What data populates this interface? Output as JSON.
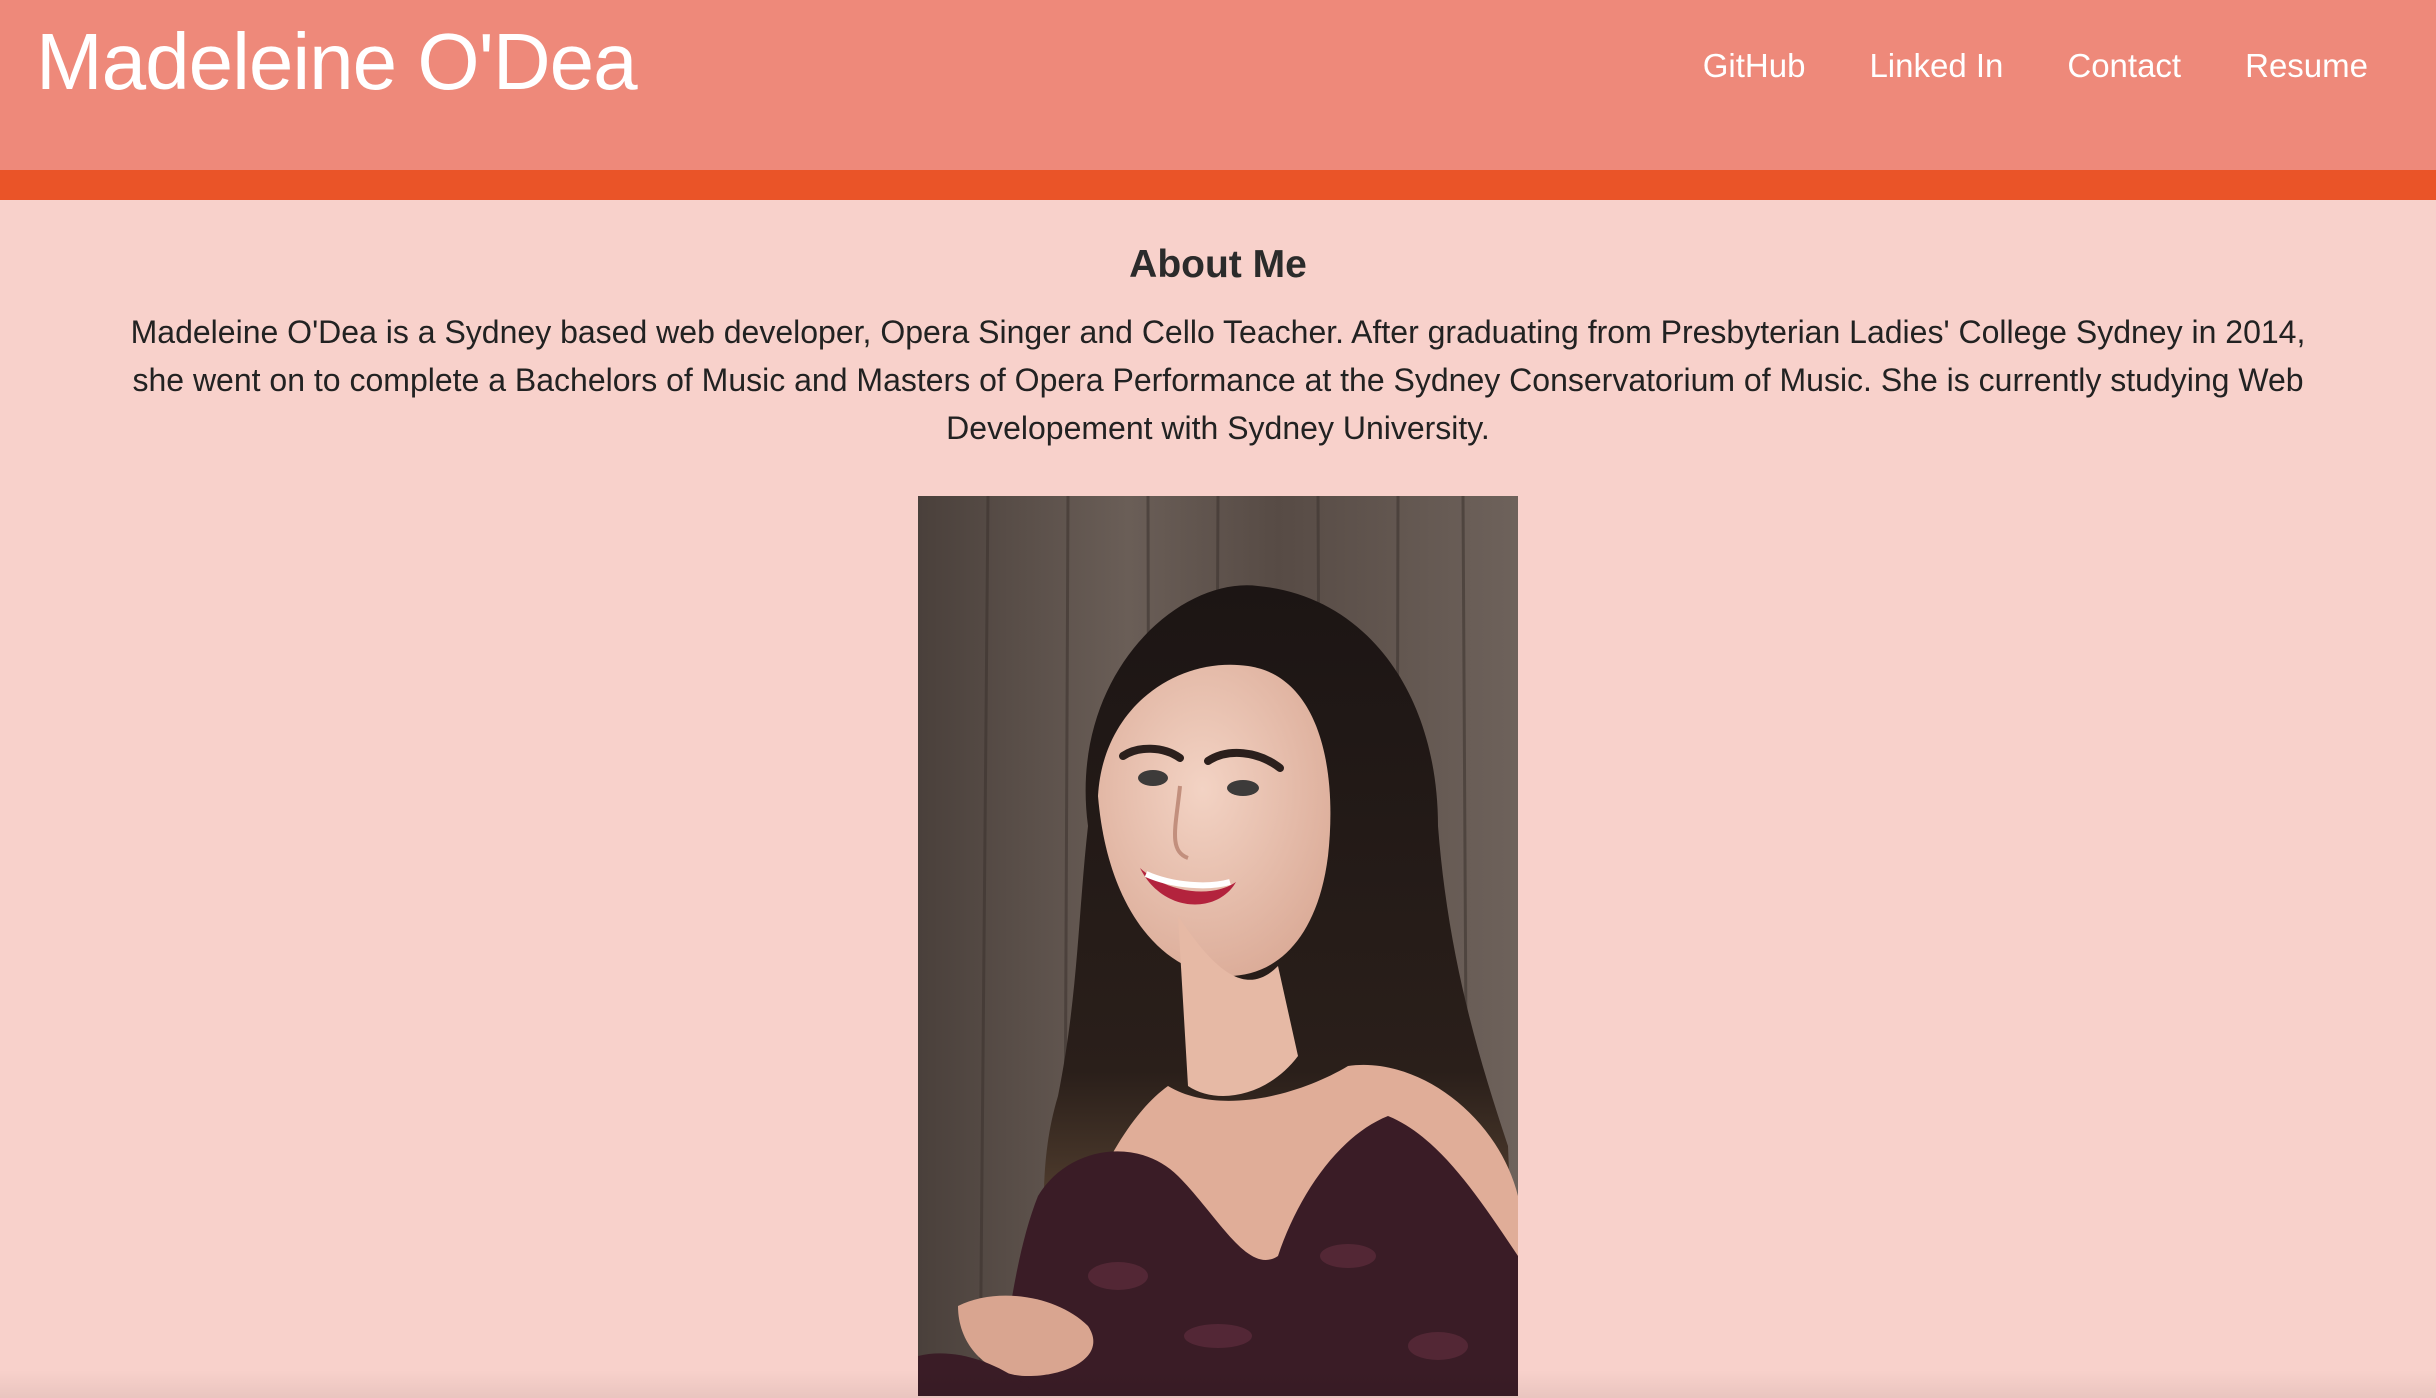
{
  "navbar": {
    "brand": "Madeleine O'Dea",
    "links": [
      {
        "label": "GitHub"
      },
      {
        "label": "Linked In"
      },
      {
        "label": "Contact"
      },
      {
        "label": "Resume"
      }
    ]
  },
  "about": {
    "heading": "About Me",
    "text": "Madeleine O'Dea is a Sydney based web developer, Opera Singer and Cello Teacher. After graduating from Presbyterian Ladies' College Sydney in 2014, she went on to complete a Bachelors of Music and Masters of Opera Performance at the Sydney Conservatorium of Music. She is currently studying Web Developement with Sydney University."
  },
  "colors": {
    "navbar_bg": "#ee897a",
    "accent_bar": "#ea5428",
    "page_bg": "#f8d1cb"
  }
}
